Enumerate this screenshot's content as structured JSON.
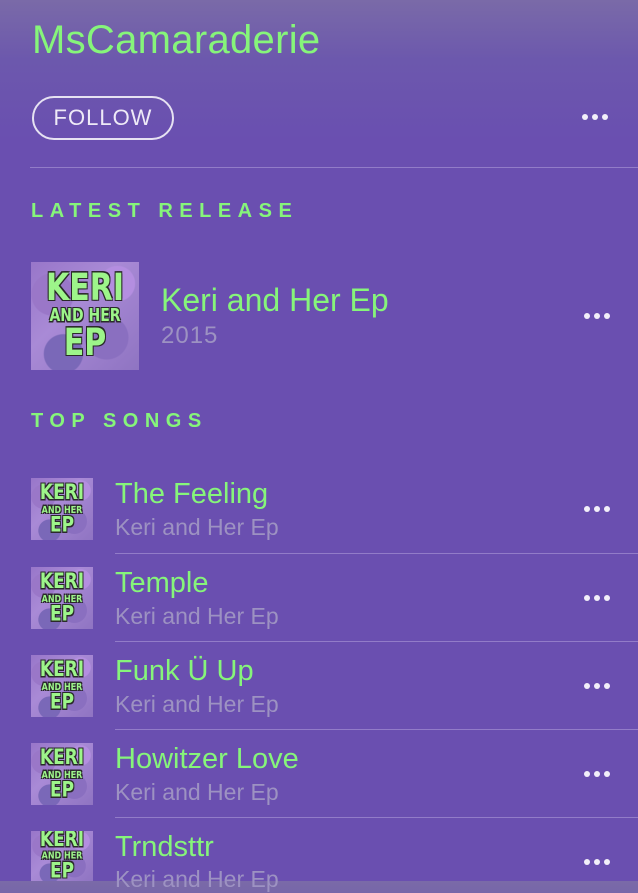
{
  "artist": {
    "name": "MsCamaraderie"
  },
  "follow_label": "FOLLOW",
  "sections": {
    "latest": "LATEST RELEASE",
    "top_songs": "TOP SONGS"
  },
  "cover_art": {
    "line1": "KERI",
    "line2": "AND HER",
    "line3": "EP"
  },
  "latest_release": {
    "title": "Keri and Her Ep",
    "year": "2015"
  },
  "songs": [
    {
      "title": "The Feeling",
      "album": "Keri and Her Ep"
    },
    {
      "title": "Temple",
      "album": "Keri and Her Ep"
    },
    {
      "title": "Funk Ü Up",
      "album": "Keri and Her Ep"
    },
    {
      "title": "Howitzer Love",
      "album": "Keri and Her Ep"
    },
    {
      "title": "Trndsttr",
      "album": "Keri and Her Ep"
    }
  ],
  "icons": {
    "more": "more-icon"
  },
  "colors": {
    "background": "#6a4fb0",
    "accent": "#86f57a",
    "secondary_text": "#9d92c2"
  }
}
